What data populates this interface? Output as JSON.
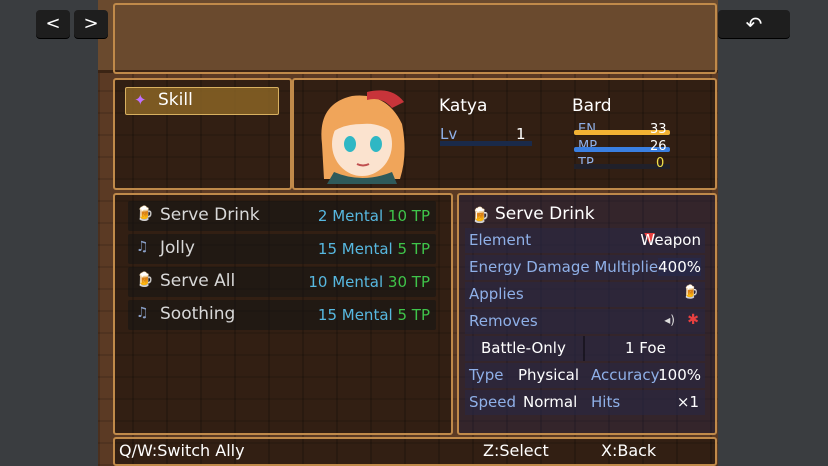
{
  "nav": {
    "prev": "<",
    "next": ">",
    "back": "↶"
  },
  "menu": {
    "skill_label": "Skill"
  },
  "actor": {
    "name": "Katya",
    "class": "Bard",
    "lv_label": "Lv",
    "lv": "1",
    "en_label": "EN",
    "en": "33",
    "mp_label": "MP",
    "mp": "26",
    "tp_label": "TP",
    "tp": "0"
  },
  "skills": [
    {
      "name": "Serve Drink",
      "mental": "2 Mental",
      "tp": "10 TP",
      "icon": "mug-icon"
    },
    {
      "name": "Jolly",
      "mental": "15 Mental",
      "tp": "5 TP",
      "icon": "note-icon"
    },
    {
      "name": "Serve All",
      "mental": "10 Mental",
      "tp": "30 TP",
      "icon": "mug-icon"
    },
    {
      "name": "Soothing",
      "mental": "15 Mental",
      "tp": "5 TP",
      "icon": "note-icon"
    }
  ],
  "detail": {
    "title": "Serve Drink",
    "element_label": "Element",
    "element_value": "Weapon",
    "energy_label": "Energy Damage Multiplie",
    "energy_value": "400%",
    "applies_label": "Applies",
    "removes_label": "Removes",
    "battle_only": "Battle-Only",
    "target": "1 Foe",
    "type_label": "Type",
    "type_value": "Physical",
    "accuracy_label": "Accuracy",
    "accuracy_value": "100%",
    "speed_label": "Speed",
    "speed_value": "Normal",
    "hits_label": "Hits",
    "hits_value": "×1"
  },
  "footer": {
    "switch": "Q/W:Switch Ally",
    "select": "Z:Select",
    "back": "X:Back"
  },
  "colors": {
    "en_bar": "#f2b233",
    "mp_bar": "#3a7fe0",
    "tp_bar": "#3fc44a"
  },
  "bars": {
    "en_fill": 1.0,
    "mp_fill": 1.0,
    "tp_fill": 0.0
  }
}
